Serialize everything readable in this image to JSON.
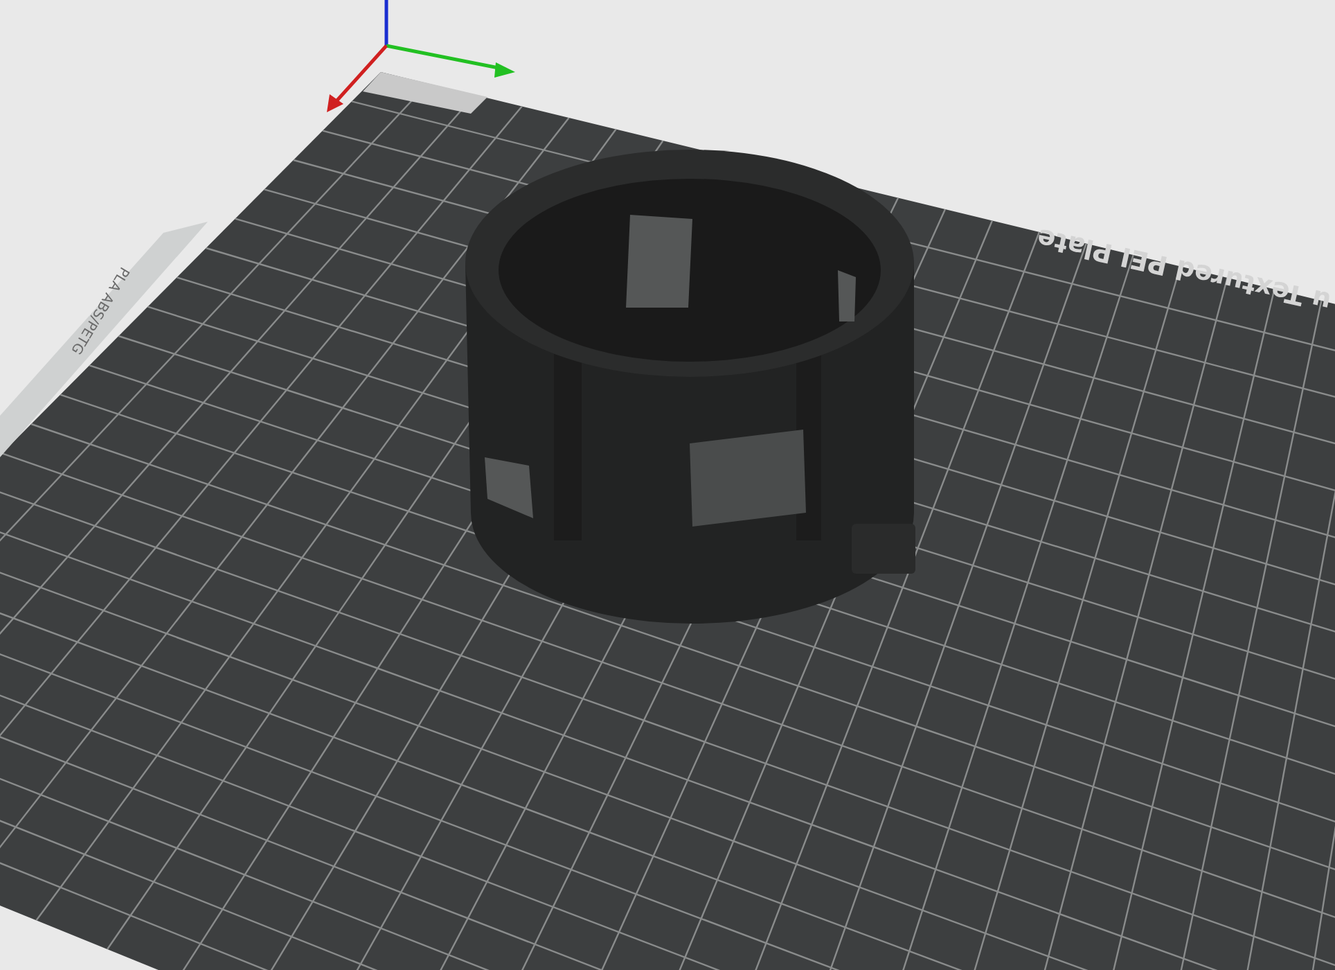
{
  "viewport": {
    "plate_label": "u Textured PEI Plate",
    "plate_tab_label": "PLA ABS/PETG"
  }
}
